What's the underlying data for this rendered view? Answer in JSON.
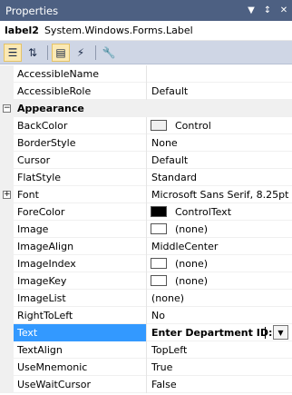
{
  "window": {
    "title": "Properties"
  },
  "object_selector": {
    "name": "label2",
    "type": "System.Windows.Forms.Label"
  },
  "toolbar": {
    "buttons": [
      {
        "icon": "categorized-icon",
        "active": true
      },
      {
        "icon": "alphabetical-icon",
        "active": false
      },
      {
        "icon": "properties-icon",
        "active": true
      },
      {
        "icon": "events-icon",
        "active": false
      },
      {
        "icon": "property-pages-icon",
        "active": false
      }
    ]
  },
  "rows": [
    {
      "name": "AccessibleName",
      "value": ""
    },
    {
      "name": "AccessibleRole",
      "value": "Default"
    },
    {
      "name": "Appearance",
      "category": true
    },
    {
      "name": "BackColor",
      "value": "Control",
      "swatch": "#f0f0f0"
    },
    {
      "name": "BorderStyle",
      "value": "None"
    },
    {
      "name": "Cursor",
      "value": "Default"
    },
    {
      "name": "FlatStyle",
      "value": "Standard"
    },
    {
      "name": "Font",
      "value": "Microsoft Sans Serif, 8.25pt",
      "expand": "+"
    },
    {
      "name": "ForeColor",
      "value": "ControlText",
      "swatch": "#000000"
    },
    {
      "name": "Image",
      "value": "(none)",
      "swatch": "#ffffff"
    },
    {
      "name": "ImageAlign",
      "value": "MiddleCenter"
    },
    {
      "name": "ImageIndex",
      "value": "(none)",
      "swatch": "#ffffff"
    },
    {
      "name": "ImageKey",
      "value": "(none)",
      "swatch": "#ffffff"
    },
    {
      "name": "ImageList",
      "value": "(none)"
    },
    {
      "name": "RightToLeft",
      "value": "No"
    },
    {
      "name": "Text",
      "value": "Enter Department ID:",
      "selected": true,
      "editing": true
    },
    {
      "name": "TextAlign",
      "value": "TopLeft"
    },
    {
      "name": "UseMnemonic",
      "value": "True"
    },
    {
      "name": "UseWaitCursor",
      "value": "False"
    }
  ],
  "colors": {
    "titlebar": "#4d6082",
    "selection": "#3399ff",
    "toolbar": "#cfd6e5"
  }
}
